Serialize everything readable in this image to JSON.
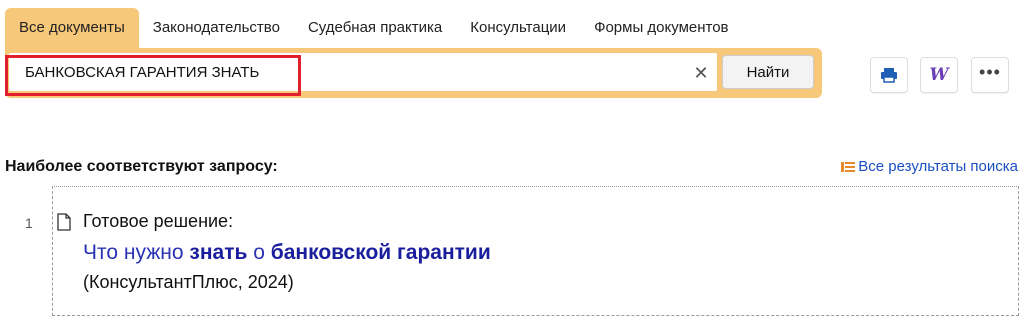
{
  "tabs": [
    "Все документы",
    "Законодательство",
    "Судебная практика",
    "Консультации",
    "Формы документов"
  ],
  "search": {
    "value": "БАНКОВСКАЯ ГАРАНТИЯ ЗНАТЬ",
    "find_label": "Найти",
    "clear_glyph": "✕"
  },
  "tools": {
    "print_icon": "print-icon",
    "word_icon": "word-icon",
    "word_glyph": "W",
    "more_glyph": "•••"
  },
  "results": {
    "title": "Наиболее соответствуют запросу:",
    "all_results_label": "Все результаты поиска",
    "items": [
      {
        "number": "1",
        "type": "Готовое решение:",
        "link_parts": [
          "Что нужно ",
          "знать",
          " о ",
          "банковской гарантии"
        ],
        "source": "(КонсультантПлюс, 2024)"
      }
    ]
  },
  "colors": {
    "accent": "#f7c879",
    "link": "#2b33b5",
    "highlight": "#e0202a"
  }
}
